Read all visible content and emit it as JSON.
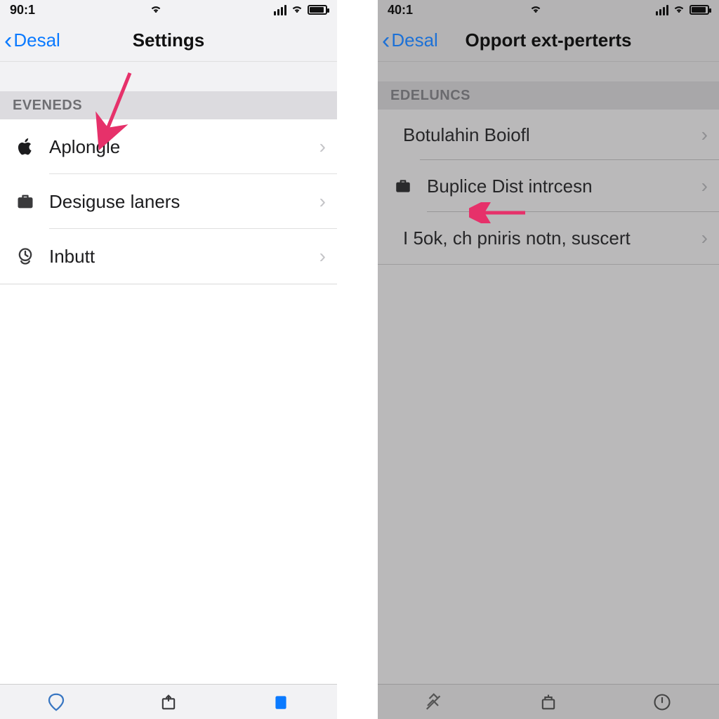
{
  "left": {
    "status_time": "90:1",
    "back_label": "Desal",
    "title": "Settings",
    "section_header": "EVENEDS",
    "rows": [
      {
        "label": "Aplongle",
        "icon": "apple"
      },
      {
        "label": "Desiguse laners",
        "icon": "briefcase"
      },
      {
        "label": "Inbutt",
        "icon": "clock"
      }
    ],
    "tabs": {
      "active_index": 2
    }
  },
  "right": {
    "status_time": "40:1",
    "back_label": "Desal",
    "title": "Opport ext-perterts",
    "section_header": "EDELUNCS",
    "rows": [
      {
        "label": "Botulahin Boiofl",
        "icon": ""
      },
      {
        "label": "Buplice Dist intrcesn",
        "icon": "briefcase"
      },
      {
        "label": "I 5ok, ch pniris notn, suscert",
        "icon": ""
      }
    ]
  },
  "colors": {
    "ios_blue": "#0a7aff",
    "arrow": "#e6316a"
  }
}
